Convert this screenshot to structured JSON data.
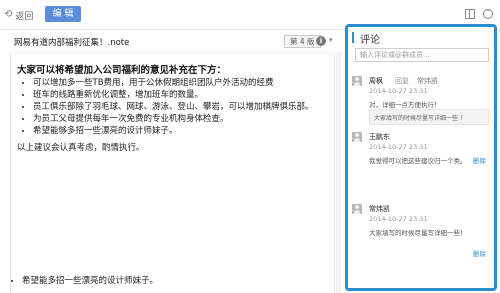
{
  "toolbar": {
    "back_label": "返回",
    "edit_label": "编 辑"
  },
  "document": {
    "title": "网易有道内部福利征集！.note",
    "version": "第 4 版",
    "heading": "大家可以将希望加入公司福利的意见补充在下方：",
    "bullets": [
      "可以增加多一些TB费用，用于公休假期组织团队户外活动的经费",
      "班车的线路重新优化调整，增加班车的数量。",
      "员工俱乐部除了羽毛球、网球、游泳、登山、攀岩，可以增加棋牌俱乐部。",
      "为员工父母提供每年一次免费的专业机构身体检查。",
      "希望能够多招一些漂亮的设计师妹子。"
    ],
    "closing": "以上建议会认真考虑，酌情执行。",
    "bottom_bullet": "希望能多招一些漂亮的设计师妹子。"
  },
  "comments_panel": {
    "title": "评论",
    "input_placeholder": "输入评论或@群成员...",
    "comments": [
      {
        "author": "周枫",
        "reply_flag": "回复",
        "reply_target": "常炜凯",
        "time": "2014-10-27 23:31",
        "text": "对，详细一点方便执行！",
        "quote": "大家填写的时候尽量写详细一些 ！",
        "delete_label": "删除"
      },
      {
        "author": "王鹏东",
        "time": "2014-10-27 23:31",
        "text": "我觉得可以把这些建议归一个类。",
        "delete_label": "删除"
      },
      {
        "author": "常炜凯",
        "time": "2014-10-27 23:31",
        "text": "大家填写的时候尽量写详细一些！",
        "delete_label": "删除"
      }
    ]
  },
  "colors": {
    "accent": "#2a8fd0",
    "edit_button": "#5b8ddb"
  }
}
